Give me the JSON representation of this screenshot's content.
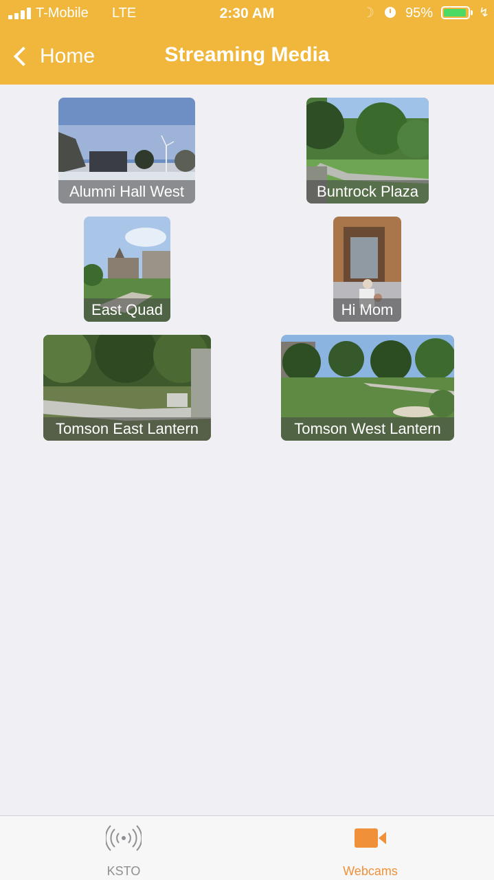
{
  "status_bar": {
    "carrier": "T-Mobile",
    "network": "LTE",
    "time": "2:30 AM",
    "battery_percent_text": "95%",
    "battery_level": 0.95,
    "signal_bars": 4,
    "icons": [
      "signal-icon",
      "moon-icon",
      "alarm-icon",
      "battery-icon",
      "charging-bolt-icon"
    ]
  },
  "nav": {
    "back_label": "Home",
    "title": "Streaming Media"
  },
  "webcams": [
    {
      "label": "Alumni Hall West"
    },
    {
      "label": "Buntrock Plaza"
    },
    {
      "label": "East Quad"
    },
    {
      "label": "Hi Mom"
    },
    {
      "label": "Tomson East Lantern"
    },
    {
      "label": "Tomson West Lantern"
    }
  ],
  "tabbar": {
    "tabs": [
      {
        "label": "KSTO",
        "icon": "radio-broadcast-icon",
        "selected": false
      },
      {
        "label": "Webcams",
        "icon": "video-camera-icon",
        "selected": true
      }
    ]
  },
  "colors": {
    "header": "#f0b73c",
    "background": "#efeff4",
    "tab_active": "#f0913a",
    "tab_inactive": "#8e8e93",
    "battery": "#4cd964"
  }
}
